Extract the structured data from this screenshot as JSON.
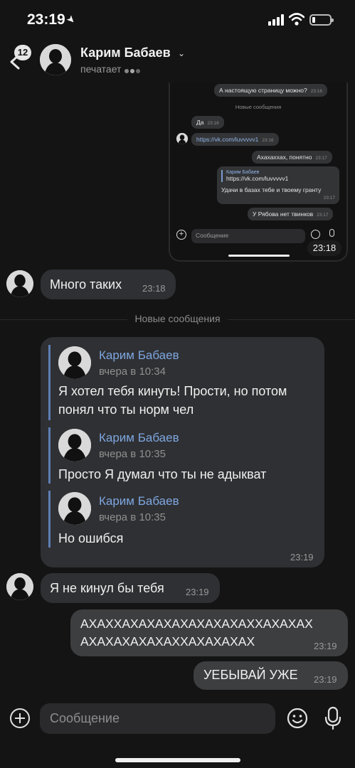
{
  "status_bar": {
    "time": "23:19"
  },
  "header": {
    "back_badge": "12",
    "contact_name": "Карим Бабаев",
    "status": "печатает"
  },
  "embedded_screenshot": {
    "messages": [
      {
        "text": "А настоящую страницу можно?",
        "time": "23:16",
        "direction": "out"
      },
      {
        "text": "Да",
        "time": "23:16",
        "direction": "in"
      },
      {
        "text": "https://vk.com/luvvvvv1",
        "time": "23:16",
        "direction": "in"
      },
      {
        "text": "Ахахаххах, понятно",
        "time": "23:17",
        "direction": "out"
      },
      {
        "text": "Удачи в базах тебе и твоему гранту",
        "time": "23:17",
        "direction": "out",
        "quote_name": "Карим Бабаев",
        "quote_text": "https://vk.com/luvvvvv1"
      },
      {
        "text": "У Рябова нет твинков",
        "time": "23:17",
        "direction": "out"
      }
    ],
    "new_messages_label": "Новые сообщения",
    "input_placeholder": "Сообщение",
    "time_overlay": "23:18"
  },
  "chat": {
    "divider_label": "Новые сообщения",
    "messages": [
      {
        "text": "Много таких",
        "time": "23:18",
        "direction": "in"
      },
      {
        "type": "forwarded",
        "time": "23:19",
        "items": [
          {
            "name": "Карим Бабаев",
            "date": "вчера в 10:34",
            "text": "Я хотел тебя кинуть! Прости, но потом понял что ты норм чел"
          },
          {
            "name": "Карим Бабаев",
            "date": "вчера в 10:35",
            "text": "Просто Я думал что ты не адыкват"
          },
          {
            "name": "Карим Бабаев",
            "date": "вчера в 10:35",
            "text": "Но ошибся"
          }
        ]
      },
      {
        "text": "Я не кинул бы тебя",
        "time": "23:19",
        "direction": "in"
      },
      {
        "text_line1": "АХАХХАХАХАХАХАХАХАХАХХАХАХАХ",
        "text_line2": "АХАХАХАХАХАХХАХАХАХАХ",
        "time": "23:19",
        "direction": "out"
      },
      {
        "text": "УЕБЫВАЙ УЖЕ",
        "time": "23:19",
        "direction": "out"
      }
    ]
  },
  "composer": {
    "placeholder": "Сообщение"
  },
  "icons": [
    "location-arrow-icon",
    "signal-icon",
    "wifi-icon",
    "battery-icon",
    "back-arrow-icon",
    "chevron-down-icon",
    "plus-icon",
    "emoji-icon",
    "microphone-icon"
  ]
}
